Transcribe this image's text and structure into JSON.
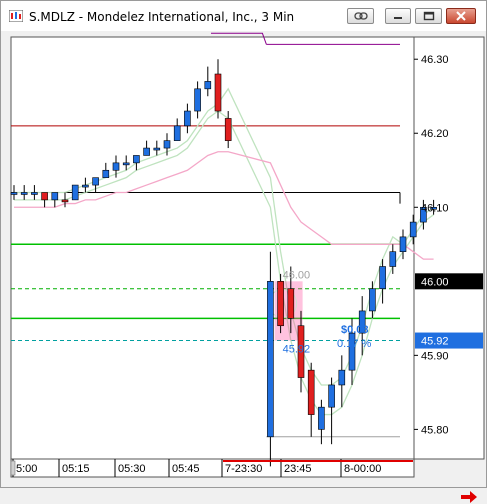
{
  "window": {
    "title": "S.MDLZ - Mondelez International, Inc., 3 Min",
    "buttons": [
      "link-icon",
      "minimize-icon",
      "restore-icon",
      "close-icon"
    ]
  },
  "colors": {
    "up": "#1f6fe0",
    "down": "#e01f1f",
    "price_tag_blue": "#1f6fe0",
    "price_tag_black": "#000000",
    "axis_bg": "#ffffff",
    "pink_band": "#ff4fa0",
    "ma_green": "#bfe3bf",
    "ma_pink": "#f4a7c8"
  },
  "price_axis": {
    "tick_labels": [
      "46.30",
      "46.20",
      "46.10",
      "45.90",
      "45.80"
    ],
    "current_price_tag": "46.00",
    "blue_price_tag": "45.92"
  },
  "annotations": {
    "top_label": "46.00",
    "bottom_label": "45.92",
    "delta_value": "$0.08",
    "delta_percent": "0.17 %"
  },
  "chart_data": {
    "type": "candlestick",
    "title": "S.MDLZ - Mondelez International, Inc., 3 Min",
    "x_labels": [
      "5:00",
      "05:15",
      "05:30",
      "05:45",
      "7-23:30",
      "23:45",
      "8-00:00"
    ],
    "ylim": [
      45.76,
      46.33
    ],
    "candles": [
      {
        "o": 46.12,
        "h": 46.13,
        "l": 46.11,
        "c": 46.12,
        "dir": "up"
      },
      {
        "o": 46.12,
        "h": 46.13,
        "l": 46.11,
        "c": 46.12,
        "dir": "up"
      },
      {
        "o": 46.12,
        "h": 46.13,
        "l": 46.11,
        "c": 46.12,
        "dir": "up"
      },
      {
        "o": 46.12,
        "h": 46.12,
        "l": 46.1,
        "c": 46.11,
        "dir": "down"
      },
      {
        "o": 46.11,
        "h": 46.12,
        "l": 46.1,
        "c": 46.12,
        "dir": "up"
      },
      {
        "o": 46.11,
        "h": 46.12,
        "l": 46.1,
        "c": 46.11,
        "dir": "down"
      },
      {
        "o": 46.11,
        "h": 46.13,
        "l": 46.11,
        "c": 46.13,
        "dir": "up"
      },
      {
        "o": 46.13,
        "h": 46.14,
        "l": 46.12,
        "c": 46.13,
        "dir": "up"
      },
      {
        "o": 46.13,
        "h": 46.14,
        "l": 46.12,
        "c": 46.14,
        "dir": "up"
      },
      {
        "o": 46.14,
        "h": 46.16,
        "l": 46.14,
        "c": 46.15,
        "dir": "up"
      },
      {
        "o": 46.15,
        "h": 46.17,
        "l": 46.14,
        "c": 46.16,
        "dir": "up"
      },
      {
        "o": 46.16,
        "h": 46.17,
        "l": 46.15,
        "c": 46.16,
        "dir": "up"
      },
      {
        "o": 46.16,
        "h": 46.17,
        "l": 46.15,
        "c": 46.17,
        "dir": "up"
      },
      {
        "o": 46.17,
        "h": 46.19,
        "l": 46.17,
        "c": 46.18,
        "dir": "up"
      },
      {
        "o": 46.18,
        "h": 46.19,
        "l": 46.17,
        "c": 46.18,
        "dir": "up"
      },
      {
        "o": 46.18,
        "h": 46.2,
        "l": 46.17,
        "c": 46.19,
        "dir": "up"
      },
      {
        "o": 46.19,
        "h": 46.22,
        "l": 46.19,
        "c": 46.21,
        "dir": "up"
      },
      {
        "o": 46.21,
        "h": 46.24,
        "l": 46.2,
        "c": 46.23,
        "dir": "up"
      },
      {
        "o": 46.23,
        "h": 46.27,
        "l": 46.22,
        "c": 46.26,
        "dir": "up"
      },
      {
        "o": 46.26,
        "h": 46.29,
        "l": 46.25,
        "c": 46.27,
        "dir": "up"
      },
      {
        "o": 46.28,
        "h": 46.3,
        "l": 46.22,
        "c": 46.23,
        "dir": "down"
      },
      {
        "o": 46.22,
        "h": 46.23,
        "l": 46.18,
        "c": 46.19,
        "dir": "down"
      },
      {
        "o": 45.79,
        "h": 46.04,
        "l": 45.75,
        "c": 46.0,
        "dir": "up"
      },
      {
        "o": 46.0,
        "h": 46.01,
        "l": 45.93,
        "c": 45.94,
        "dir": "down"
      },
      {
        "o": 45.99,
        "h": 46.02,
        "l": 45.93,
        "c": 45.95,
        "dir": "down"
      },
      {
        "o": 45.94,
        "h": 45.96,
        "l": 45.85,
        "c": 45.87,
        "dir": "down"
      },
      {
        "o": 45.88,
        "h": 45.89,
        "l": 45.79,
        "c": 45.82,
        "dir": "down"
      },
      {
        "o": 45.8,
        "h": 45.84,
        "l": 45.78,
        "c": 45.83,
        "dir": "up"
      },
      {
        "o": 45.83,
        "h": 45.87,
        "l": 45.78,
        "c": 45.86,
        "dir": "up"
      },
      {
        "o": 45.86,
        "h": 45.9,
        "l": 45.83,
        "c": 45.88,
        "dir": "up"
      },
      {
        "o": 45.88,
        "h": 45.95,
        "l": 45.86,
        "c": 45.93,
        "dir": "up"
      },
      {
        "o": 45.93,
        "h": 45.98,
        "l": 45.9,
        "c": 45.96,
        "dir": "up"
      },
      {
        "o": 45.96,
        "h": 46.0,
        "l": 45.95,
        "c": 45.99,
        "dir": "up"
      },
      {
        "o": 45.99,
        "h": 46.03,
        "l": 45.97,
        "c": 46.02,
        "dir": "up"
      },
      {
        "o": 46.02,
        "h": 46.05,
        "l": 46.01,
        "c": 46.04,
        "dir": "up"
      },
      {
        "o": 46.04,
        "h": 46.07,
        "l": 46.03,
        "c": 46.06,
        "dir": "up"
      },
      {
        "o": 46.06,
        "h": 46.09,
        "l": 46.05,
        "c": 46.08,
        "dir": "up"
      },
      {
        "o": 46.08,
        "h": 46.11,
        "l": 46.07,
        "c": 46.1,
        "dir": "up"
      },
      {
        "o": 46.1,
        "h": 46.11,
        "l": 46.09,
        "c": 46.1,
        "dir": "up"
      }
    ],
    "horizontal_levels": [
      {
        "price": 46.32,
        "color": "#8b008b",
        "style": "solid",
        "span": "right"
      },
      {
        "price": 46.21,
        "color": "#b00000",
        "style": "solid",
        "span": "full"
      },
      {
        "price": 46.12,
        "color": "#000000",
        "style": "solid",
        "span": "full"
      },
      {
        "price": 46.05,
        "color": "#00c000",
        "style": "solid",
        "span": "full"
      },
      {
        "price": 45.99,
        "color": "#00b000",
        "style": "dashed",
        "span": "full"
      },
      {
        "price": 45.95,
        "color": "#00c000",
        "style": "solid",
        "span": "full"
      },
      {
        "price": 45.92,
        "color": "#00a0a0",
        "style": "dashed",
        "span": "full"
      },
      {
        "price": 45.79,
        "color": "#a0a0a0",
        "style": "solid",
        "span": "right"
      }
    ],
    "grid": false,
    "legend": "none"
  }
}
